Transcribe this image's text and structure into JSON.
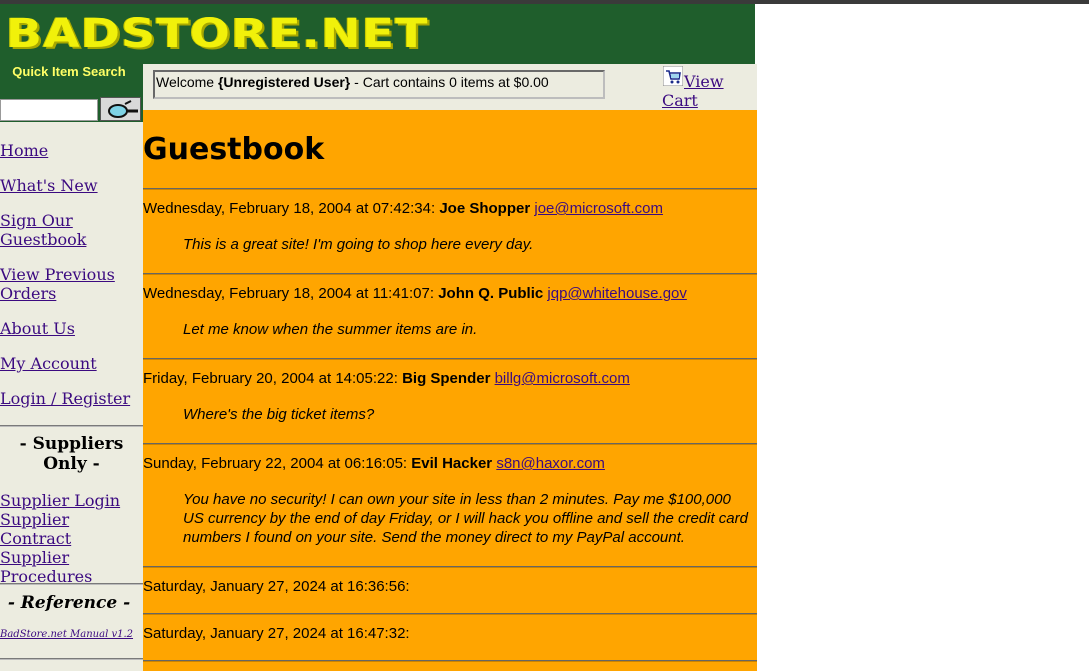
{
  "header": {
    "logo_text": "BADSTORE.NET"
  },
  "quick_search": {
    "title": "Quick Item Search",
    "value": ""
  },
  "nav": {
    "items": [
      {
        "label": "Home"
      },
      {
        "label": "What's New"
      },
      {
        "label": "Sign Our Guestbook"
      },
      {
        "label": "View Previous Orders"
      },
      {
        "label": "About Us"
      },
      {
        "label": "My Account"
      },
      {
        "label": "Login / Register"
      }
    ]
  },
  "suppliers": {
    "title": "- Suppliers Only -",
    "links": [
      {
        "label": "Supplier Login"
      },
      {
        "label": "Supplier Contract"
      },
      {
        "label": "Supplier Procedures"
      }
    ]
  },
  "reference": {
    "title": "- Reference -",
    "manual_label": "BadStore.net Manual v1.2"
  },
  "welcome": {
    "prefix": "Welcome ",
    "user": "{Unregistered User}",
    "suffix": " - Cart contains 0 items at $0.00"
  },
  "cart": {
    "view_label": "View Cart",
    "icon": "shopping-cart-icon"
  },
  "main": {
    "title": "Guestbook"
  },
  "entries": [
    {
      "date": "Wednesday, February 18, 2004 at 07:42:34:",
      "name": "Joe Shopper",
      "email": "joe@microsoft.com",
      "message": "This is a great site! I'm going to shop here every day."
    },
    {
      "date": "Wednesday, February 18, 2004 at 11:41:07:",
      "name": "John Q. Public",
      "email": "jqp@whitehouse.gov",
      "message": "Let me know when the summer items are in."
    },
    {
      "date": "Friday, February 20, 2004 at 14:05:22:",
      "name": "Big Spender",
      "email": "billg@microsoft.com",
      "message": "Where's the big ticket items?"
    },
    {
      "date": "Sunday, February 22, 2004 at 06:16:05:",
      "name": "Evil Hacker",
      "email": "s8n@haxor.com",
      "message": "You have no security! I can own your site in less than 2 minutes. Pay me $100,000 US currency by the end of day Friday, or I will hack you offline and sell the credit card numbers I found on your site. Send the money direct to my PayPal account."
    },
    {
      "date": "Saturday, January 27, 2024 at 16:36:56:",
      "name": "",
      "email": "",
      "message": ""
    },
    {
      "date": "Saturday, January 27, 2024 at 16:47:32:",
      "name": "",
      "email": "",
      "message": ""
    }
  ],
  "colors": {
    "header_bg": "#1f5e2c",
    "logo": "#f1f10a",
    "main_bg": "#ffa500",
    "sidebar_bg": "#ecece0",
    "link": "#3b0a80"
  }
}
